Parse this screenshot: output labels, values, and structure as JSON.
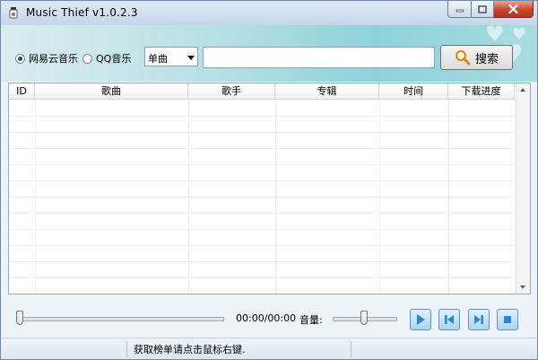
{
  "window": {
    "title": "Music Thief  v1.0.2.3"
  },
  "source": {
    "options": [
      {
        "label": "网易云音乐",
        "checked": true
      },
      {
        "label": "QQ音乐",
        "checked": false
      }
    ]
  },
  "search": {
    "type_selected": "单曲",
    "query_value": "",
    "query_placeholder": "",
    "button_label": "搜索"
  },
  "table": {
    "columns": [
      "ID",
      "歌曲",
      "歌手",
      "专辑",
      "时间",
      "下载进度"
    ],
    "rows": []
  },
  "player": {
    "progress": 0,
    "time_display": "00:00/00:00",
    "volume_label": "音量:",
    "volume_level": 0.5
  },
  "status": {
    "text": "获取榜单请点击鼠标右键."
  },
  "colors": {
    "accent": "#8fd1d9",
    "titlebar": "#c5d6ea",
    "close_button": "#c7462f",
    "player_buttons": "#a9d6f3",
    "player_icons": "#2f86c6"
  },
  "icons": {
    "app": "music-note-icon",
    "search": "magnifier-icon",
    "play": "play-icon",
    "prev": "previous-icon",
    "next": "next-icon",
    "stop": "stop-icon"
  }
}
